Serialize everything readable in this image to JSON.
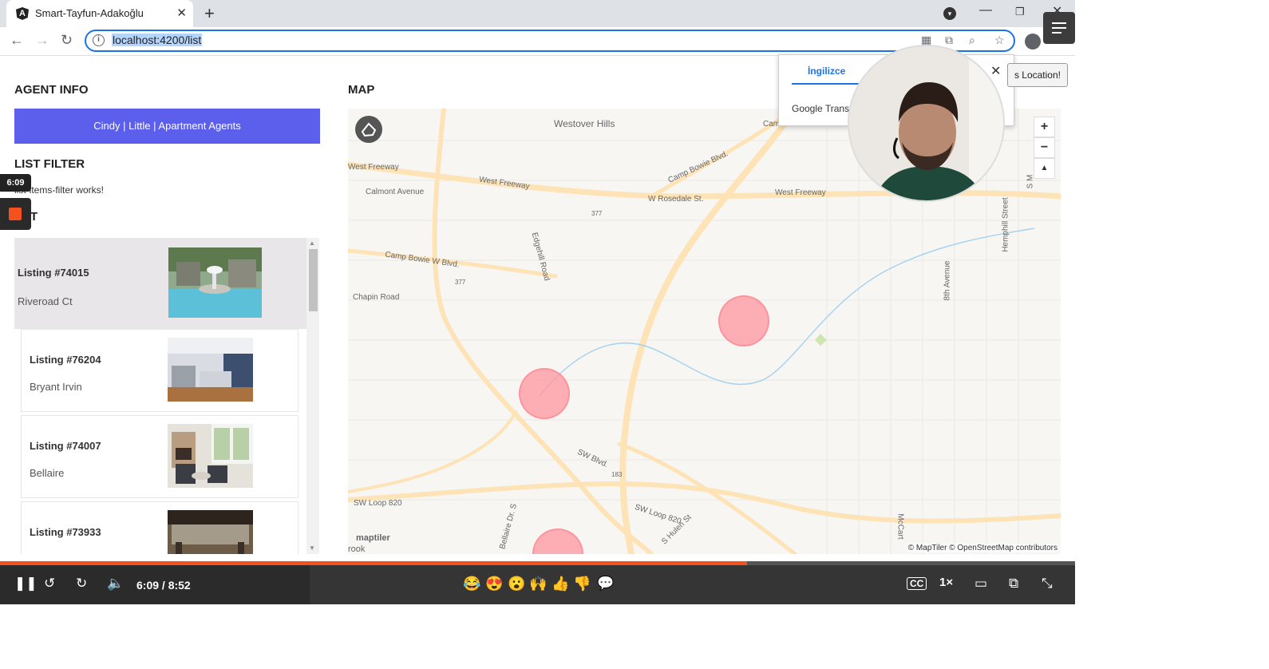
{
  "browser": {
    "tab_title": "Smart-Tayfun-Adakoğlu",
    "url": "localhost:4200/list"
  },
  "page": {
    "agent_info_title": "AGENT INFO",
    "agent_button": "Cindy | Little | Apartment Agents",
    "list_filter_title": "LIST FILTER",
    "list_filter_text": "list-items-filter works!",
    "list_title_partial": "T",
    "map_title": "MAP"
  },
  "listings": [
    {
      "id": "Listing #74015",
      "street": "Riveroad Ct"
    },
    {
      "id": "Listing #76204",
      "street": "Bryant Irvin"
    },
    {
      "id": "Listing #74007",
      "street": "Bellaire"
    },
    {
      "id": "Listing #73933",
      "street": ""
    }
  ],
  "map": {
    "labels": [
      "Westover Hills",
      "West Freeway",
      "Calmont Avenue",
      "West Freeway",
      "Camp Bowie Blvd.",
      "W Rosedale St.",
      "West Freeway",
      "377",
      "Edgehill Road",
      "Camp Bowie W Blvd.",
      "377",
      "Chapin Road",
      "Hemphill Street",
      "8th Avenue",
      "SW Blvd.",
      "183",
      "SW Loop 820",
      "SW Loop 820",
      "Bellaire Dr. S",
      "S Hulen St",
      "McCart",
      "rook",
      "S M",
      "Cam"
    ],
    "attribution": "© MapTiler © OpenStreetMap contributors",
    "logo": "maptiler",
    "zoom_in": "+",
    "zoom_out": "−",
    "compass": "▲"
  },
  "translate": {
    "tab": "İngilizce",
    "brand": "Google Transl",
    "location_button": "s Location!"
  },
  "recorder": {
    "elapsed": "6:09"
  },
  "player": {
    "time": "6:09 / 8:52",
    "progress": 0.695,
    "speed": "1×",
    "cc": "CC",
    "emojis": [
      "😂",
      "😍",
      "😮",
      "🙌",
      "👍",
      "👎"
    ]
  },
  "colors": {
    "accent": "#5b5fec",
    "progress": "#f4511e",
    "marker": "#ff96a0"
  }
}
